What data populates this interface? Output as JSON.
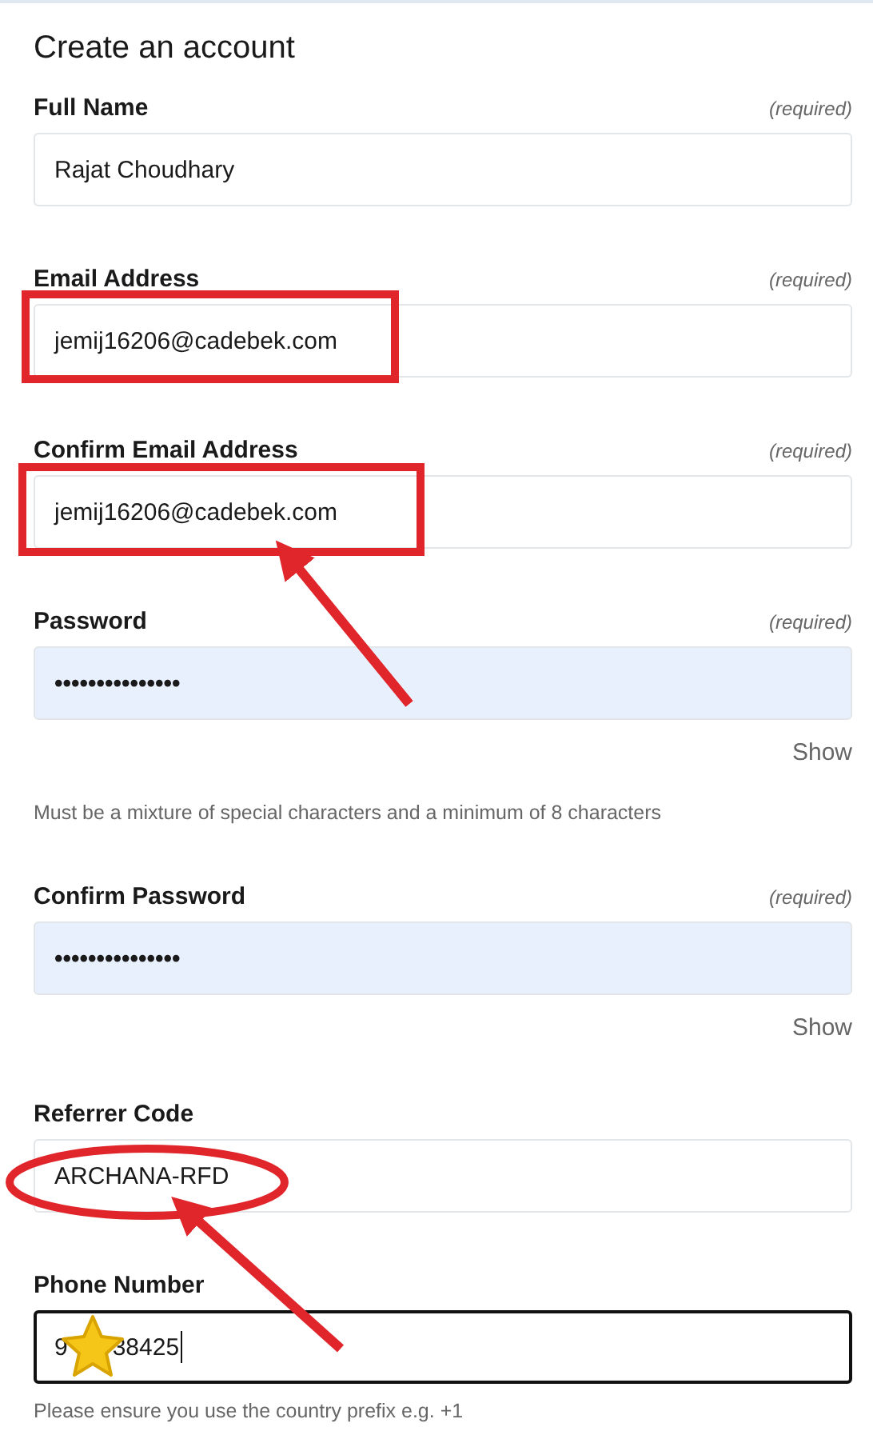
{
  "title": "Create an account",
  "fields": [
    {
      "label": "Full Name",
      "required_note": "(required)",
      "kind": "text",
      "value": "Rajat Choudhary",
      "autofilled": false,
      "focused": false
    },
    {
      "label": "Email Address",
      "required_note": "(required)",
      "kind": "text",
      "value": "jemij16206@cadebek.com",
      "autofilled": false,
      "focused": false
    },
    {
      "label": "Confirm Email Address",
      "required_note": "(required)",
      "kind": "text",
      "value": "jemij16206@cadebek.com",
      "autofilled": false,
      "focused": false
    },
    {
      "label": "Password",
      "required_note": "(required)",
      "kind": "password",
      "value": "•••••••••••••••",
      "autofilled": true,
      "focused": false,
      "toggle": "Show",
      "hint": "Must be a mixture of special characters and a minimum of 8 characters"
    },
    {
      "label": "Confirm Password",
      "required_note": "(required)",
      "kind": "password",
      "value": "•••••••••••••••",
      "autofilled": true,
      "focused": false,
      "toggle": "Show"
    },
    {
      "label": "Referrer Code",
      "kind": "text",
      "value": "ARCHANA-RFD",
      "autofilled": false,
      "focused": false
    },
    {
      "label": "Phone Number",
      "kind": "covered",
      "value_start": "9",
      "value_end": "38425",
      "autofilled": false,
      "focused": true,
      "hint": "Please ensure you use the country prefix e.g. +1"
    }
  ]
}
